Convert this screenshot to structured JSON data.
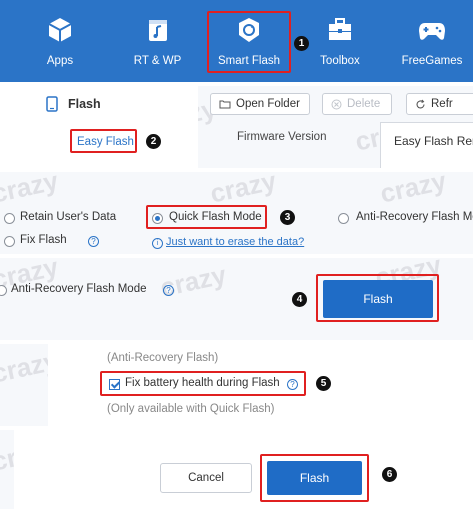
{
  "toolbar": {
    "items": [
      {
        "label": "Apps",
        "icon": "apps-icon"
      },
      {
        "label": "RT & WP",
        "icon": "ringtone-wallpaper-icon"
      },
      {
        "label": "Smart Flash",
        "icon": "smart-flash-icon"
      },
      {
        "label": "Toolbox",
        "icon": "toolbox-icon"
      },
      {
        "label": "FreeGames",
        "icon": "gamepad-icon"
      }
    ],
    "bg_color": "#2b74c7"
  },
  "steps": [
    "1",
    "2",
    "3",
    "4",
    "5",
    "6"
  ],
  "flash_panel": {
    "title": "Flash",
    "easy_flash": "Easy Flash",
    "open_folder": "Open Folder",
    "delete": "Delete",
    "refresh": "Refr",
    "col_firmware": "Firmware Version",
    "col_easy_flash": "Easy Flash Ren"
  },
  "modes": {
    "retain": "Retain User's Data",
    "quick": "Quick Flash Mode",
    "anti_recovery": "Anti-Recovery Flash Mo",
    "fix_flash": "Fix Flash",
    "erase_link": "Just want to erase the data?"
  },
  "anti_panel": {
    "label": "Anti-Recovery Flash Mode",
    "flash_button": "Flash"
  },
  "options_panel": {
    "anti_note": "(Anti-Recovery Flash)",
    "fix_battery": "Fix battery health during Flash",
    "quick_only": "(Only available with Quick Flash)"
  },
  "dialog": {
    "cancel": "Cancel",
    "flash": "Flash"
  },
  "watermark": "crazy",
  "accent_color": "#e02020"
}
